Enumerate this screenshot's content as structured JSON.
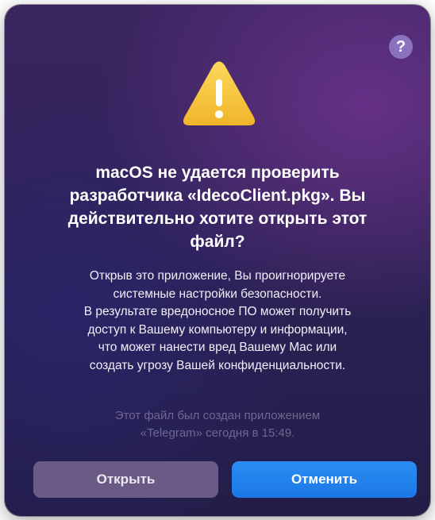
{
  "dialog": {
    "help_label": "?",
    "icon": "warning-triangle-icon",
    "title": "macOS не удается проверить разработчика «IdecoClient.pkg». Вы действительно хотите открыть этот файл?",
    "title_lines": [
      "macOS не удается проверить",
      "разработчика «IdecoClient.pkg». Вы",
      "действительно хотите открыть этот",
      "файл?"
    ],
    "body_lines": [
      "Открыв это приложение, Вы проигнорируете",
      "системные настройки безопасности.",
      "В результате вредоносное ПО может получить",
      "доступ к Вашему компьютеру и информации,",
      "что может нанести вред Вашему Mac или",
      "создать угрозу Вашей конфиденциальности."
    ],
    "info_lines": [
      "Этот файл был создан приложением",
      "«Telegram» сегодня в 15:49."
    ],
    "buttons": {
      "open_label": "Открыть",
      "cancel_label": "Отменить"
    }
  },
  "colors": {
    "dialog_background": "#2f2257",
    "help_button": "#8b72bf",
    "warning_yellow": "#f5c33b",
    "open_button": "#6a5b86",
    "cancel_button": "#1f7fed",
    "info_text": "#6f6790"
  }
}
